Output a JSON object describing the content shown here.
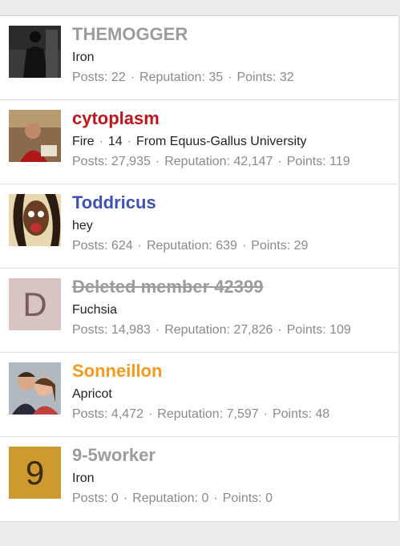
{
  "members": [
    {
      "username": "THEMOGGER",
      "name_color": "#9c9c9c",
      "avatar_icon": "silhouette-photo",
      "title_parts": [
        "Iron"
      ],
      "posts_label": "Posts:",
      "posts": "22",
      "rep_label": "Reputation:",
      "reputation": "35",
      "points_label": "Points:",
      "points": "32"
    },
    {
      "username": "cytoplasm",
      "name_color": "#c0141a",
      "avatar_icon": "person-photo",
      "title_parts": [
        "Fire",
        "14",
        "From Equus-Gallus University"
      ],
      "posts_label": "Posts:",
      "posts": "27,935",
      "rep_label": "Reputation:",
      "reputation": "42,147",
      "points_label": "Points:",
      "points": "119"
    },
    {
      "username": "Toddricus",
      "name_color": "#3f51b5",
      "avatar_icon": "face-photo",
      "title_parts": [
        "hey"
      ],
      "posts_label": "Posts:",
      "posts": "624",
      "rep_label": "Reputation:",
      "reputation": "639",
      "points_label": "Points:",
      "points": "29"
    },
    {
      "username": "Deleted member 42399",
      "name_color": "#9c9c9c",
      "avatar_letter": "D",
      "avatar_bg": "#d9c4c4",
      "avatar_fg": "#7a5b5b",
      "title_parts": [
        "Fuchsia"
      ],
      "posts_label": "Posts:",
      "posts": "14,983",
      "rep_label": "Reputation:",
      "reputation": "27,826",
      "points_label": "Points:",
      "points": "109"
    },
    {
      "username": "Sonneillon",
      "name_color": "#f49a1e",
      "avatar_icon": "couple-photo",
      "title_parts": [
        "Apricot"
      ],
      "posts_label": "Posts:",
      "posts": "4,472",
      "rep_label": "Reputation:",
      "reputation": "7,597",
      "points_label": "Points:",
      "points": "48"
    },
    {
      "username": "9-5worker",
      "name_color": "#9c9c9c",
      "avatar_letter": "9",
      "avatar_bg": "#cc9a2e",
      "avatar_fg": "#3a2a10",
      "title_parts": [
        "Iron"
      ],
      "posts_label": "Posts:",
      "posts": "0",
      "rep_label": "Reputation:",
      "reputation": "0",
      "points_label": "Points:",
      "points": "0"
    }
  ],
  "separator": "·"
}
